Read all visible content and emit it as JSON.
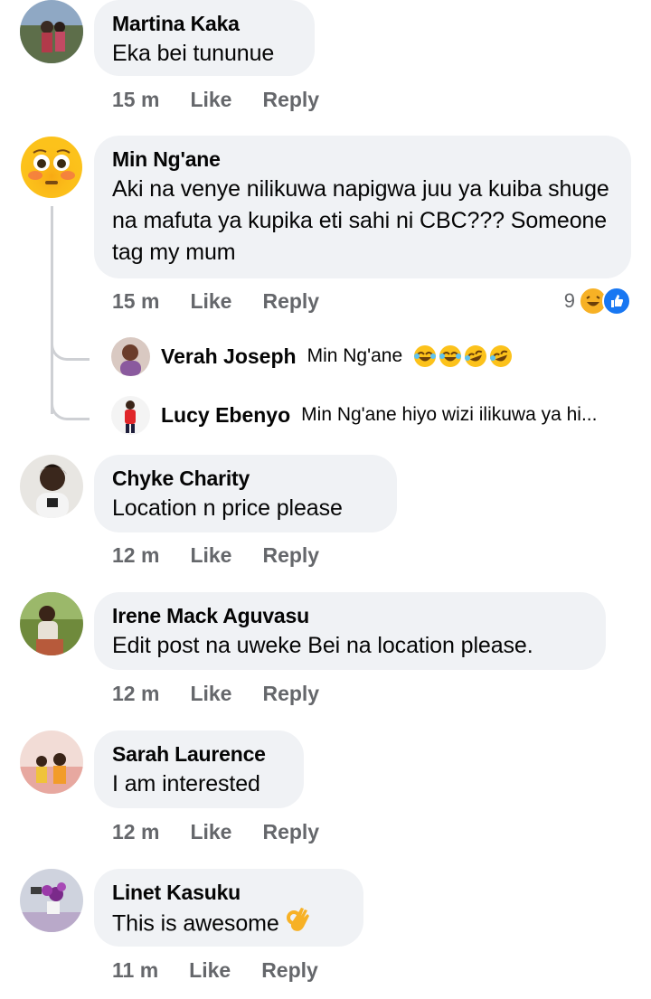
{
  "comments": [
    {
      "author": "Martina Kaka",
      "text": "Eka bei tununue",
      "time": "15 m",
      "like": "Like",
      "reply": "Reply"
    },
    {
      "author": "Min Ng'ane",
      "text": "Aki na venye nilikuwa napigwa juu ya kuiba shuge na mafuta ya kupika eti sahi ni CBC??? Someone tag my mum",
      "time": "15 m",
      "like": "Like",
      "reply": "Reply",
      "reaction_count": "9",
      "replies": [
        {
          "author": "Verah Joseph",
          "text": "Min Ng'ane"
        },
        {
          "author": "Lucy Ebenyo",
          "text": "Min Ng'ane hiyo wizi ilikuwa ya hi..."
        }
      ]
    },
    {
      "author": "Chyke Charity",
      "text": "Location n price please",
      "time": "12 m",
      "like": "Like",
      "reply": "Reply"
    },
    {
      "author": "Irene Mack Aguvasu",
      "text": "Edit post na uweke Bei na location please.",
      "time": "12 m",
      "like": "Like",
      "reply": "Reply"
    },
    {
      "author": "Sarah Laurence",
      "text": "I am interested",
      "time": "12 m",
      "like": "Like",
      "reply": "Reply"
    },
    {
      "author": "Linet Kasuku",
      "text": "This is awesome",
      "time": "11 m",
      "like": "Like",
      "reply": "Reply"
    }
  ],
  "colors": {
    "bubble": "#f0f2f5",
    "meta": "#65676b",
    "like_blue": "#1877f2",
    "haha_yellow": "#f7b125"
  },
  "icons": {
    "haha": "laughing-emoji-icon",
    "like": "thumbs-up-icon",
    "ok_hand": "ok-hand-emoji-icon",
    "flushed": "flushed-emoji-icon"
  }
}
